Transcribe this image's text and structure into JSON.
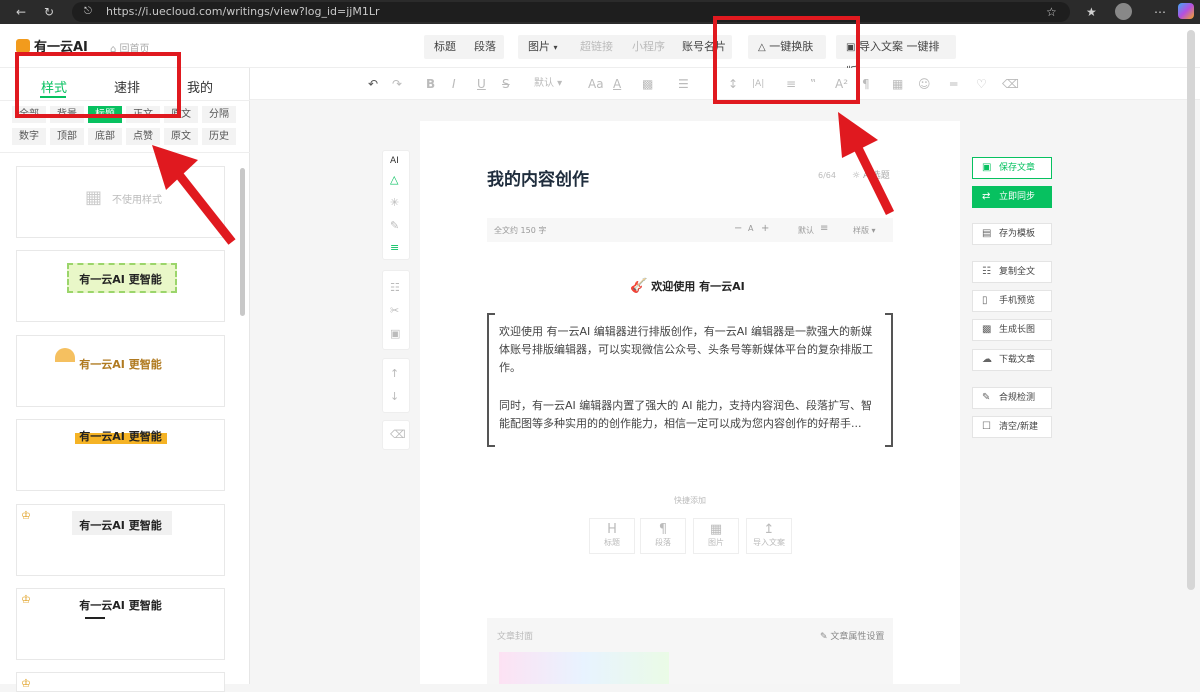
{
  "browser": {
    "url": "https://i.uecloud.com/writings/view?log_id=jjM1Lr",
    "icons": [
      "back-arrow-icon",
      "refresh-icon",
      "lock-icon",
      "star-icon",
      "favorites-icon",
      "profile-icon",
      "menu-icon",
      "copilot-icon"
    ]
  },
  "header": {
    "logo": "有一云AI",
    "back_home": "回首页",
    "buttons": {
      "title": "标题",
      "paragraph": "段落",
      "image": "图片",
      "hyperlink": "超链接",
      "mini_program": "小程序",
      "account_card": "账号名片",
      "one_click_skin": "一键换肤",
      "import": "导入文案",
      "one_click_layout": "一键排版"
    }
  },
  "toolbar": {
    "font_default": "默认",
    "icons": [
      "undo-icon",
      "redo-icon",
      "bold-icon",
      "italic-icon",
      "underline-icon",
      "strikethrough-icon",
      "font-style-icon",
      "font-color-icon",
      "align-icon",
      "line-height-icon",
      "letter-spacing-icon",
      "list-icon",
      "quote-icon",
      "superscript-icon",
      "paragraph-icon",
      "table-icon",
      "emoji-icon",
      "divider-icon",
      "brush-icon",
      "eraser-icon"
    ]
  },
  "left_panel": {
    "tabs": {
      "style": "样式",
      "quick": "速排",
      "mine": "我的"
    },
    "categories_row1": [
      "全部",
      "背景",
      "标题",
      "正文",
      "原文",
      "分隔"
    ],
    "categories_row2": [
      "数字",
      "顶部",
      "底部",
      "点赞",
      "原文",
      "历史"
    ],
    "no_style": "不使用样式",
    "card_text": "有一云AI 更智能"
  },
  "editor": {
    "title": "我的内容创作",
    "title_count": "6/64",
    "title_ai": "AI选题",
    "word_count": "全文约 150 字",
    "font_size_letter": "A",
    "font_default": "默认",
    "layout": "样版",
    "welcome": "欢迎使用 有一云AI",
    "para1": "欢迎使用 有一云AI 编辑器进行排版创作，有一云AI 编辑器是一款强大的新媒体账号排版编辑器，可以实现微信公众号、头条号等新媒体平台的复杂排版工作。",
    "para2": "同时，有一云AI 编辑器内置了强大的 AI 能力，支持内容润色、段落扩写、智能配图等多种实用的的创作能力，相信一定可以成为您内容创作的好帮手...",
    "quick_add": "快捷添加",
    "quick_buttons": {
      "title": "标题",
      "paragraph": "段落",
      "image": "图片",
      "import": "导入文案"
    },
    "cover_label": "文章封面",
    "attr_settings": "文章属性设置"
  },
  "right_panel": {
    "save": "保存文章",
    "sync": "立即同步",
    "template": "存为模板",
    "copy": "复制全文",
    "preview": "手机预览",
    "long_image": "生成长图",
    "download": "下载文章",
    "compliance": "合规检测",
    "clear": "清空/新建"
  },
  "vtools": {
    "ai_label": "AI"
  },
  "colors": {
    "brand_green": "#07c160",
    "annotation_red": "#e0191f"
  }
}
